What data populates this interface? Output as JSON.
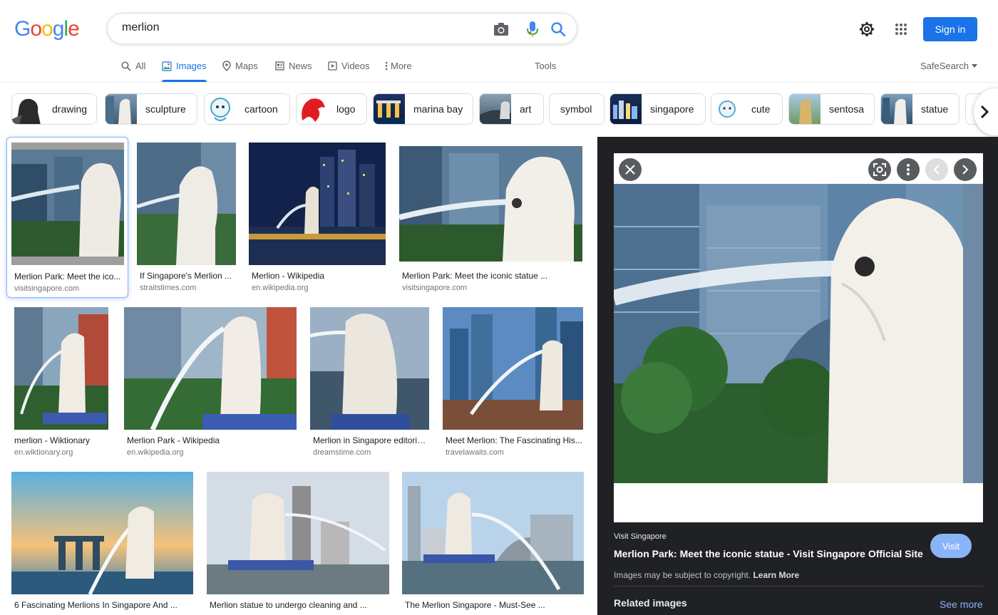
{
  "logo": "Google",
  "search": {
    "query": "merlion"
  },
  "header": {
    "signin_label": "Sign in"
  },
  "tabs": [
    {
      "label": "All",
      "icon": "search-icon"
    },
    {
      "label": "Images",
      "icon": "image-icon",
      "active": true
    },
    {
      "label": "Maps",
      "icon": "map-pin-icon"
    },
    {
      "label": "News",
      "icon": "newspaper-icon"
    },
    {
      "label": "Videos",
      "icon": "play-icon"
    },
    {
      "label": "More",
      "icon": "dots-vertical-icon"
    }
  ],
  "tools_label": "Tools",
  "safesearch_label": "SafeSearch",
  "chips": [
    "drawing",
    "sculpture",
    "cartoon",
    "logo",
    "marina bay",
    "art",
    "symbol",
    "singapore",
    "cute",
    "sentosa",
    "statue"
  ],
  "results": [
    {
      "title": "Merlion Park: Meet the ico...",
      "source": "visitsingapore.com"
    },
    {
      "title": "If Singapore's Merlion ...",
      "source": "straitstimes.com"
    },
    {
      "title": "Merlion - Wikipedia",
      "source": "en.wikipedia.org"
    },
    {
      "title": "Merlion Park: Meet the iconic statue ...",
      "source": "visitsingapore.com"
    },
    {
      "title": "merlion - Wiktionary",
      "source": "en.wiktionary.org"
    },
    {
      "title": "Merlion Park - Wikipedia",
      "source": "en.wikipedia.org"
    },
    {
      "title": "Merlion in Singapore editoria...",
      "source": "dreamstime.com"
    },
    {
      "title": "Meet Merlion: The Fascinating His...",
      "source": "travelawaits.com"
    },
    {
      "title": "6 Fascinating Merlions In Singapore And ...",
      "source": ""
    },
    {
      "title": "Merlion statue to undergo cleaning and ...",
      "source": ""
    },
    {
      "title": "The Merlion Singapore - Must-See ...",
      "source": ""
    }
  ],
  "panel": {
    "source": "Visit Singapore",
    "title": "Merlion Park: Meet the iconic statue - Visit Singapore Official Site",
    "visit_label": "Visit",
    "copyright": "Images may be subject to copyright.",
    "learn_more": "Learn More",
    "related_label": "Related images",
    "see_more": "See more"
  }
}
